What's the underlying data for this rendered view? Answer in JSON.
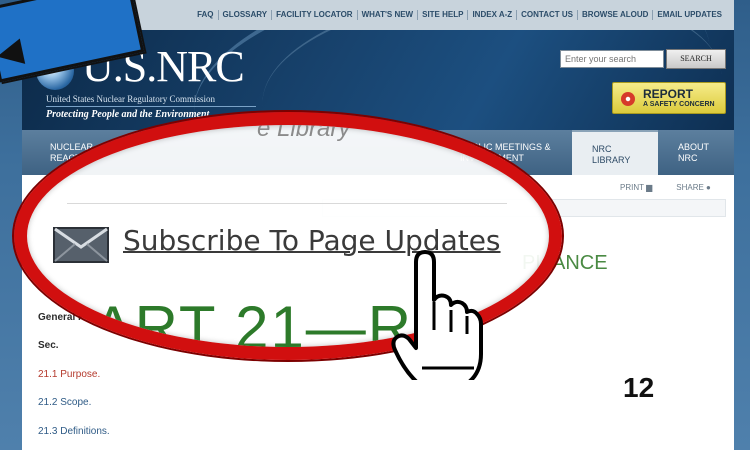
{
  "utility_bar": {
    "links": [
      "FAQ",
      "GLOSSARY",
      "FACILITY LOCATOR",
      "WHAT'S NEW",
      "SITE HELP",
      "INDEX A-Z",
      "CONTACT US",
      "BROWSE ALOUD",
      "EMAIL UPDATES"
    ]
  },
  "header": {
    "logo_title": "U.S.NRC",
    "logo_subtitle": "United States Nuclear Regulatory Commission",
    "tagline": "Protecting People and the Environment",
    "search_placeholder": "Enter your search",
    "search_button": "SEARCH",
    "report_main": "REPORT",
    "report_sub": "A SAFETY CONCERN"
  },
  "nav": {
    "items": [
      {
        "label": "NUCLEAR\nREACTORS",
        "active": false
      },
      {
        "label": "PUBLIC MEETINGS &\nINVOLVEMENT",
        "active": false
      },
      {
        "label": "NRC\nLIBRARY",
        "active": true
      },
      {
        "label": "ABOUT\nNRC",
        "active": false
      }
    ]
  },
  "tools": {
    "print": "PRINT",
    "share": "SHARE"
  },
  "content": {
    "part_title_visible": "PLIANCE",
    "general_label": "General P",
    "sec_label": "Sec.",
    "sections": [
      "21.1 Purpose.",
      "21.2 Scope.",
      "21.3 Definitions."
    ]
  },
  "zoom": {
    "faint_library": "e Library",
    "subscribe_label": "Subscribe To Page Updates",
    "part_big": "PART 21—RE"
  },
  "step_number": "12",
  "colors": {
    "highlight_ring": "#d10f0f",
    "nrc_navy": "#17416b",
    "title_green": "#4a8a43",
    "link_red": "#b4392c",
    "callout_blue": "#1f71c6"
  }
}
